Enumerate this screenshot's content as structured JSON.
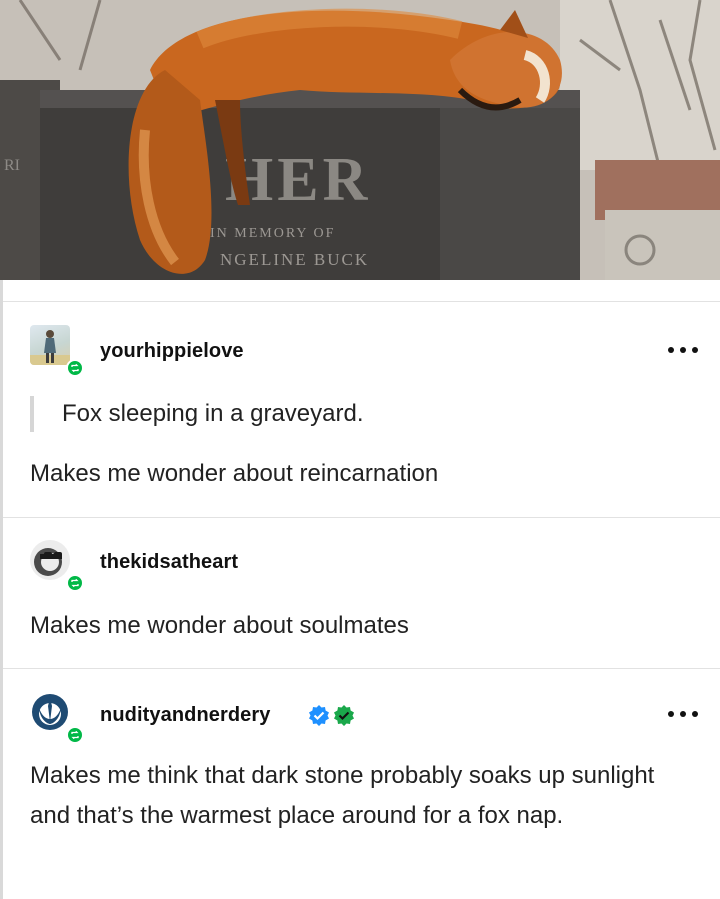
{
  "photo": {
    "headstone_engraving_large": "HER",
    "headstone_engraving_line1": "IN MEMORY OF",
    "headstone_engraving_line2": "NGELINE BUCK",
    "left_stone_fragment": "RI"
  },
  "posts": [
    {
      "username": "yourhippielove",
      "quote": "Fox sleeping in a graveyard.",
      "comment": "Makes me wonder about reincarnation",
      "avatar_icon": "person-photo-avatar",
      "badge_icon": "reblog-icon"
    },
    {
      "username": "thekidsatheart",
      "comment": "Makes me wonder about soulmates",
      "avatar_icon": "sunglasses-face-avatar",
      "badge_icon": "reblog-icon"
    },
    {
      "username": "nudityandnerdery",
      "comment": "Makes me think that dark stone probably soaks up sunlight and that’s the warmest place around for a fox nap.",
      "avatar_icon": "rebel-alliance-avatar",
      "badge_icon": "reblog-icon",
      "verified_icons": [
        "blue-check-badge-icon",
        "green-check-badge-icon"
      ]
    }
  ],
  "colors": {
    "reblog_green": "#01b847",
    "verified_blue": "#1e90ff",
    "verified_green": "#1aa84b",
    "fox_orange": "#c9671f"
  }
}
